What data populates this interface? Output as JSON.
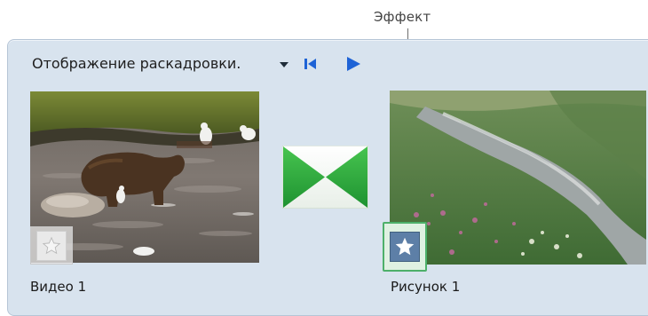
{
  "callout": {
    "effect_label": "Эффект"
  },
  "toolbar": {
    "view_label": "Отображение раскадровки.",
    "dropdown_icon": "chevron-down-icon",
    "first_icon": "skip-to-start-icon",
    "play_icon": "play-icon"
  },
  "storyboard": {
    "items": [
      {
        "label": "Видео 1",
        "effect_icon": "star-icon"
      },
      {
        "label": "Рисунок 1",
        "effect_icon": "star-icon"
      }
    ],
    "transition_icon": "transition-icon"
  },
  "colors": {
    "panel_background": "#d8e3ee",
    "accent_blue": "#1e63d6",
    "transition_green": "#2fae3d",
    "effect_highlight": "#4db06a"
  }
}
